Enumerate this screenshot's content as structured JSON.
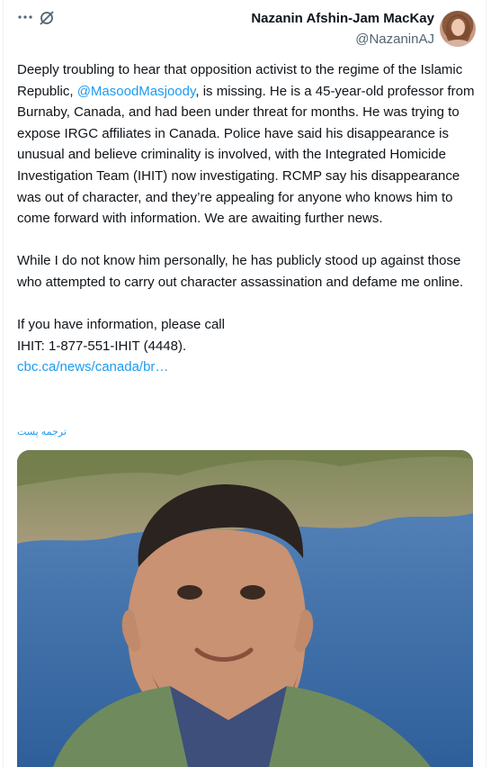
{
  "author": {
    "name": "Nazanin Afshin-Jam MacKay",
    "handle": "@NazaninAJ"
  },
  "header": {
    "more_icon": "more-horizontal-icon",
    "grok_icon": "grok-icon"
  },
  "tweet": {
    "p1_before": "Deeply troubling to hear that opposition activist to the regime of the Islamic Republic, ",
    "p1_mention": "@MasoodMasjoody",
    "p1_after": ", is missing. He is a 45-year-old professor from Burnaby, Canada, and had been under threat for months. He was trying to expose IRGC affiliates in Canada. Police have said his disappearance is unusual and believe criminality is involved, with the Integrated Homicide Investigation Team (IHIT) now investigating. RCMP say his disappearance was out of character, and they’re appealing for anyone who knows him to come forward with information. We are awaiting further news.",
    "p2": "While I do not know him personally, he has publicly stood up against those who attempted to carry out character assassination and defame me online.",
    "p3_line1": "If you have information, please call",
    "p3_line2": "IHIT: 1-877-551-IHIT (4448).",
    "link": "cbc.ca/news/canada/br…",
    "translate": "ترجمه پست"
  },
  "colors": {
    "link": "#1d9bf0",
    "text": "#0f1419",
    "secondary": "#536471",
    "sea": "#3f6fa8"
  }
}
